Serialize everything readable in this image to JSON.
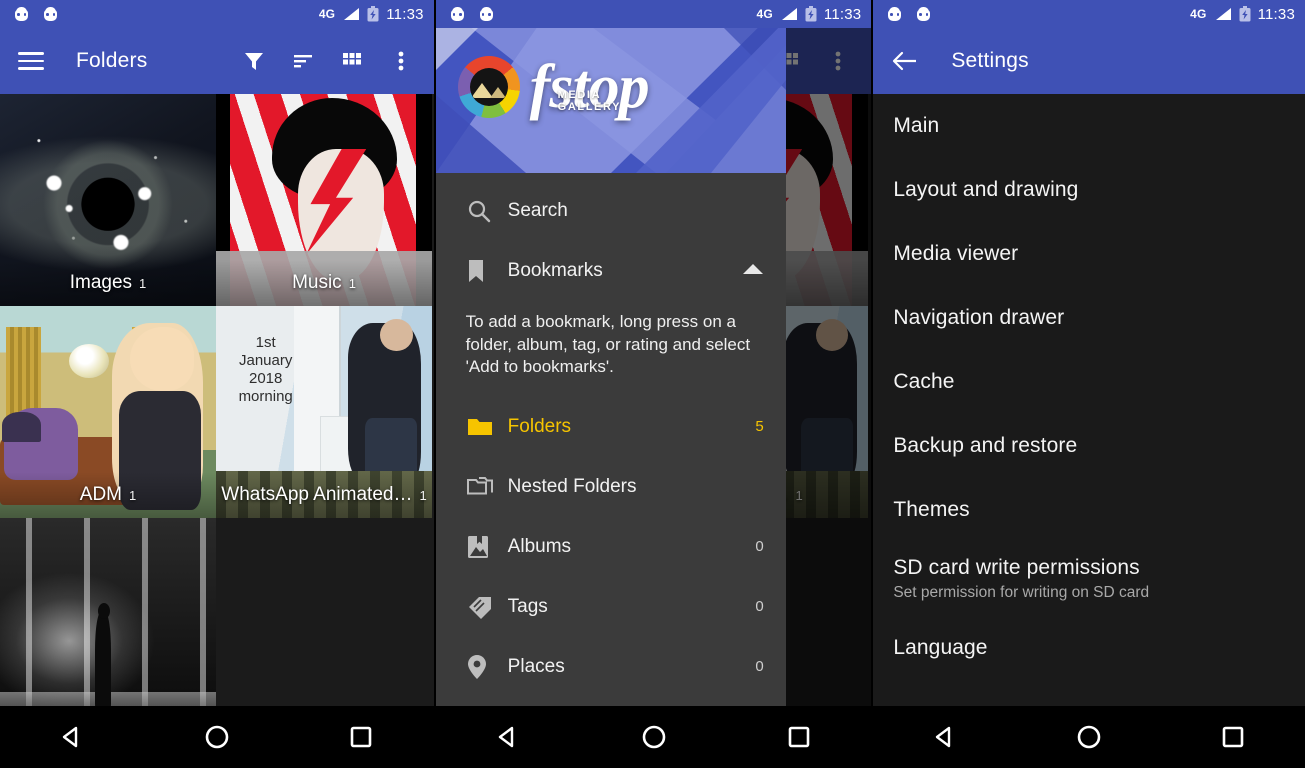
{
  "statusbar": {
    "network": "4G",
    "time": "11:33",
    "icons": [
      "robot-icon",
      "robot-icon",
      "signal-icon",
      "battery-charging-icon"
    ]
  },
  "panel1": {
    "toolbar": {
      "menu_icon": "hamburger-menu-icon",
      "title": "Folders",
      "actions": [
        {
          "name": "filter-icon",
          "label": "Filter"
        },
        {
          "name": "sort-icon",
          "label": "Sort"
        },
        {
          "name": "grid-view-icon",
          "label": "Grid view"
        },
        {
          "name": "overflow-menu-icon",
          "label": "More options"
        }
      ]
    },
    "folders": [
      {
        "name": "Images",
        "count": "1",
        "thumb": "space-black-hole"
      },
      {
        "name": "Music",
        "count": "1",
        "thumb": "bowie-aladdin-sane"
      },
      {
        "name": "ADM",
        "count": "1",
        "thumb": "cartoon-living-room"
      },
      {
        "name": "WhatsApp Animated…",
        "count": "1",
        "thumb": "new-year-video"
      },
      {
        "name": "",
        "count": "",
        "thumb": "black-white-figure"
      }
    ],
    "thumb_text": {
      "new_year": "1st\nJanuary\n2018\nmorning"
    }
  },
  "panel2": {
    "drawer": {
      "brand": {
        "name": "fstop",
        "tagline": "MEDIA GALLERY",
        "logo_icon": "fstop-color-ring-icon"
      },
      "items": [
        {
          "icon": "search-icon",
          "label": "Search",
          "count": "",
          "active": false,
          "expander": ""
        },
        {
          "icon": "bookmark-icon",
          "label": "Bookmarks",
          "count": "",
          "active": false,
          "expander": "chevron-up-icon"
        }
      ],
      "bookmark_note": "To add a bookmark, long press on a folder, album, tag, or rating and select 'Add to bookmarks'.",
      "sections": [
        {
          "icon": "folder-icon",
          "label": "Folders",
          "count": "5",
          "active": true
        },
        {
          "icon": "nested-folders-icon",
          "label": "Nested Folders",
          "count": "",
          "active": false
        },
        {
          "icon": "albums-icon",
          "label": "Albums",
          "count": "0",
          "active": false
        },
        {
          "icon": "tag-icon",
          "label": "Tags",
          "count": "0",
          "active": false
        },
        {
          "icon": "place-pin-icon",
          "label": "Places",
          "count": "0",
          "active": false
        }
      ]
    }
  },
  "panel3": {
    "toolbar": {
      "back_icon": "back-arrow-icon",
      "title": "Settings"
    },
    "items": [
      {
        "title": "Main",
        "subtitle": ""
      },
      {
        "title": "Layout and drawing",
        "subtitle": ""
      },
      {
        "title": "Media viewer",
        "subtitle": ""
      },
      {
        "title": "Navigation drawer",
        "subtitle": ""
      },
      {
        "title": "Cache",
        "subtitle": ""
      },
      {
        "title": "Backup and restore",
        "subtitle": ""
      },
      {
        "title": "Themes",
        "subtitle": ""
      },
      {
        "title": "SD card write permissions",
        "subtitle": "Set permission for writing on SD card"
      },
      {
        "title": "Language",
        "subtitle": ""
      }
    ]
  },
  "navbar": {
    "back": "back-triangle-icon",
    "home": "home-circle-icon",
    "recents": "recents-square-icon"
  },
  "colors": {
    "primary": "#3f51b5",
    "drawer_bg": "#3b3b3b",
    "settings_bg": "#1a1a1a",
    "accent": "#f6c400"
  }
}
